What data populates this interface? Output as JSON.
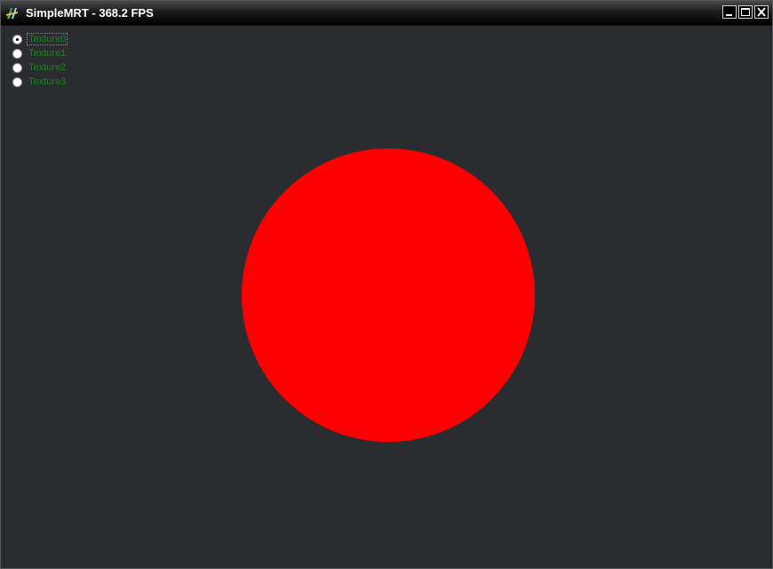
{
  "window": {
    "title": "SimpleMRT - 368.2 FPS",
    "controls": [
      "minimize-icon",
      "maximize-icon",
      "close-icon"
    ]
  },
  "radio_group": {
    "selected": "Texture0",
    "options": [
      {
        "label": "Texture0",
        "checked": true
      },
      {
        "label": "Texture1",
        "checked": false
      },
      {
        "label": "Texture2",
        "checked": false
      },
      {
        "label": "Texture3",
        "checked": false
      }
    ]
  },
  "render": {
    "background_color": "#2b2c30",
    "shape": "circle",
    "shape_color": "#ff0000"
  },
  "colors": {
    "label_green": "#0f8a12",
    "titlebar": "#000000"
  }
}
